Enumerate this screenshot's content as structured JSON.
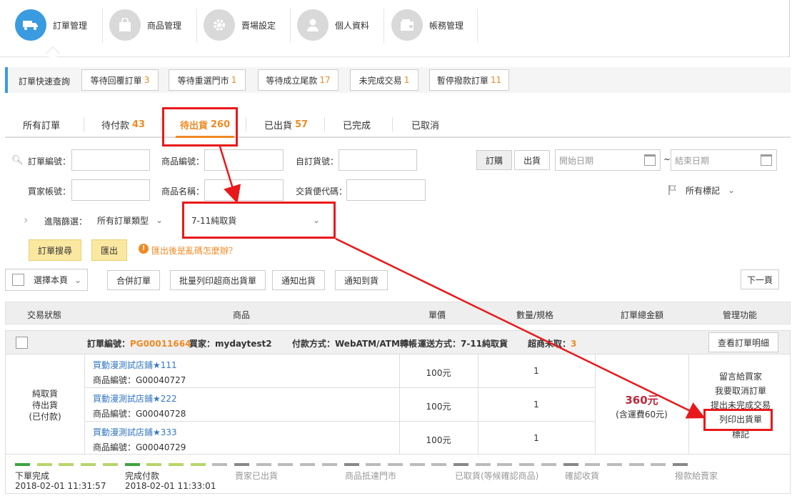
{
  "nav": {
    "items": [
      {
        "label": "訂單管理",
        "icon": "truck-icon"
      },
      {
        "label": "商品管理",
        "icon": "bag-icon"
      },
      {
        "label": "賣場設定",
        "icon": "gear-icon"
      },
      {
        "label": "個人資料",
        "icon": "user-icon"
      },
      {
        "label": "帳務管理",
        "icon": "wallet-icon"
      }
    ]
  },
  "quick": {
    "title": "訂單快速查詢",
    "buttons": [
      {
        "label": "等待回覆訂單",
        "count": "3"
      },
      {
        "label": "等待重選門市",
        "count": "1"
      },
      {
        "label": "等待成立尾款",
        "count": "17"
      },
      {
        "label": "未完成交易",
        "count": "1"
      },
      {
        "label": "暫停撥款訂單",
        "count": "11"
      }
    ]
  },
  "tabs": [
    {
      "label": "所有訂單",
      "count": ""
    },
    {
      "label": "待付款",
      "count": "43"
    },
    {
      "label": "待出貨",
      "count": "260"
    },
    {
      "label": "已出貨",
      "count": "57"
    },
    {
      "label": "已完成",
      "count": ""
    },
    {
      "label": "已取消",
      "count": ""
    }
  ],
  "filters": {
    "order_no": "訂單編號：",
    "product_no": "商品編號：",
    "self_no": "自訂貨號：",
    "buyer": "買家帳號：",
    "product_name": "商品名稱：",
    "delivery_code": "交貨便代碼：",
    "toggle_buy": "訂購",
    "toggle_ship": "出貨",
    "start_date": "開始日期",
    "tilde": "~",
    "end_date": "結束日期",
    "all_tags": "所有標記",
    "advanced": "進階篩選：",
    "order_type": "所有訂單類型",
    "shipping": "7-11純取貨",
    "search": "訂單搜尋",
    "export": "匯出",
    "export_help": "匯出後是亂碼怎麼辦？"
  },
  "actions": {
    "select_page": "選擇本頁",
    "merge": "合併訂單",
    "batch_print": "批量列印超商出貨單",
    "notify_ship": "通知出貨",
    "notify_arrive": "通知到貨",
    "next": "下一頁"
  },
  "table": {
    "headers": [
      "交易狀態",
      "商品",
      "單價",
      "數量/規格",
      "訂單總金額",
      "管理功能"
    ]
  },
  "order": {
    "no_label": "訂單編號：",
    "no": "PG00011664",
    "buyer_label": "買家：",
    "buyer": "mydaytest2",
    "pay": "付款方式：WebATM/ATM轉帳",
    "ship": "運送方式：7-11純取貨",
    "unpicked_label": "超商未取：",
    "unpicked": "3",
    "detail_btn": "查看訂單明細",
    "status": [
      "純取貨",
      "待出貨",
      "(已付款)"
    ],
    "items": [
      {
        "name": "買動漫測試店鋪★111",
        "code": "商品編號：G00040727",
        "price": "100元",
        "qty": "1"
      },
      {
        "name": "買動漫測試店鋪★222",
        "code": "商品編號：G00040728",
        "price": "100元",
        "qty": "1"
      },
      {
        "name": "買動漫測試店鋪★333",
        "code": "商品編號：G00040729",
        "price": "100元",
        "qty": "1"
      }
    ],
    "total": "360元",
    "total_note": "(含運費60元)",
    "manage": [
      "留言給買家",
      "我要取消訂單",
      "提出未完成交易",
      "列印出貨單",
      "標記"
    ]
  },
  "progress": {
    "done_fraction": 0.3,
    "steps": [
      {
        "label": "下單完成",
        "time": "2018-02-01 11:31:57",
        "done": true
      },
      {
        "label": "完成付款",
        "time": "2018-02-01 11:33:01",
        "done": true
      },
      {
        "label": "賣家已出貨",
        "time": "",
        "done": false
      },
      {
        "label": "商品抵達門市",
        "time": "",
        "done": false
      },
      {
        "label": "已取貨(等候確認商品)",
        "time": "",
        "done": false
      },
      {
        "label": "確認收貨",
        "time": "",
        "done": false
      },
      {
        "label": "撥款給賣家",
        "time": "",
        "done": false
      }
    ]
  },
  "colors": {
    "accent": "#f08a24",
    "blue": "#3a9be0",
    "highlight": "#e8191b",
    "price": "#c0273a"
  }
}
